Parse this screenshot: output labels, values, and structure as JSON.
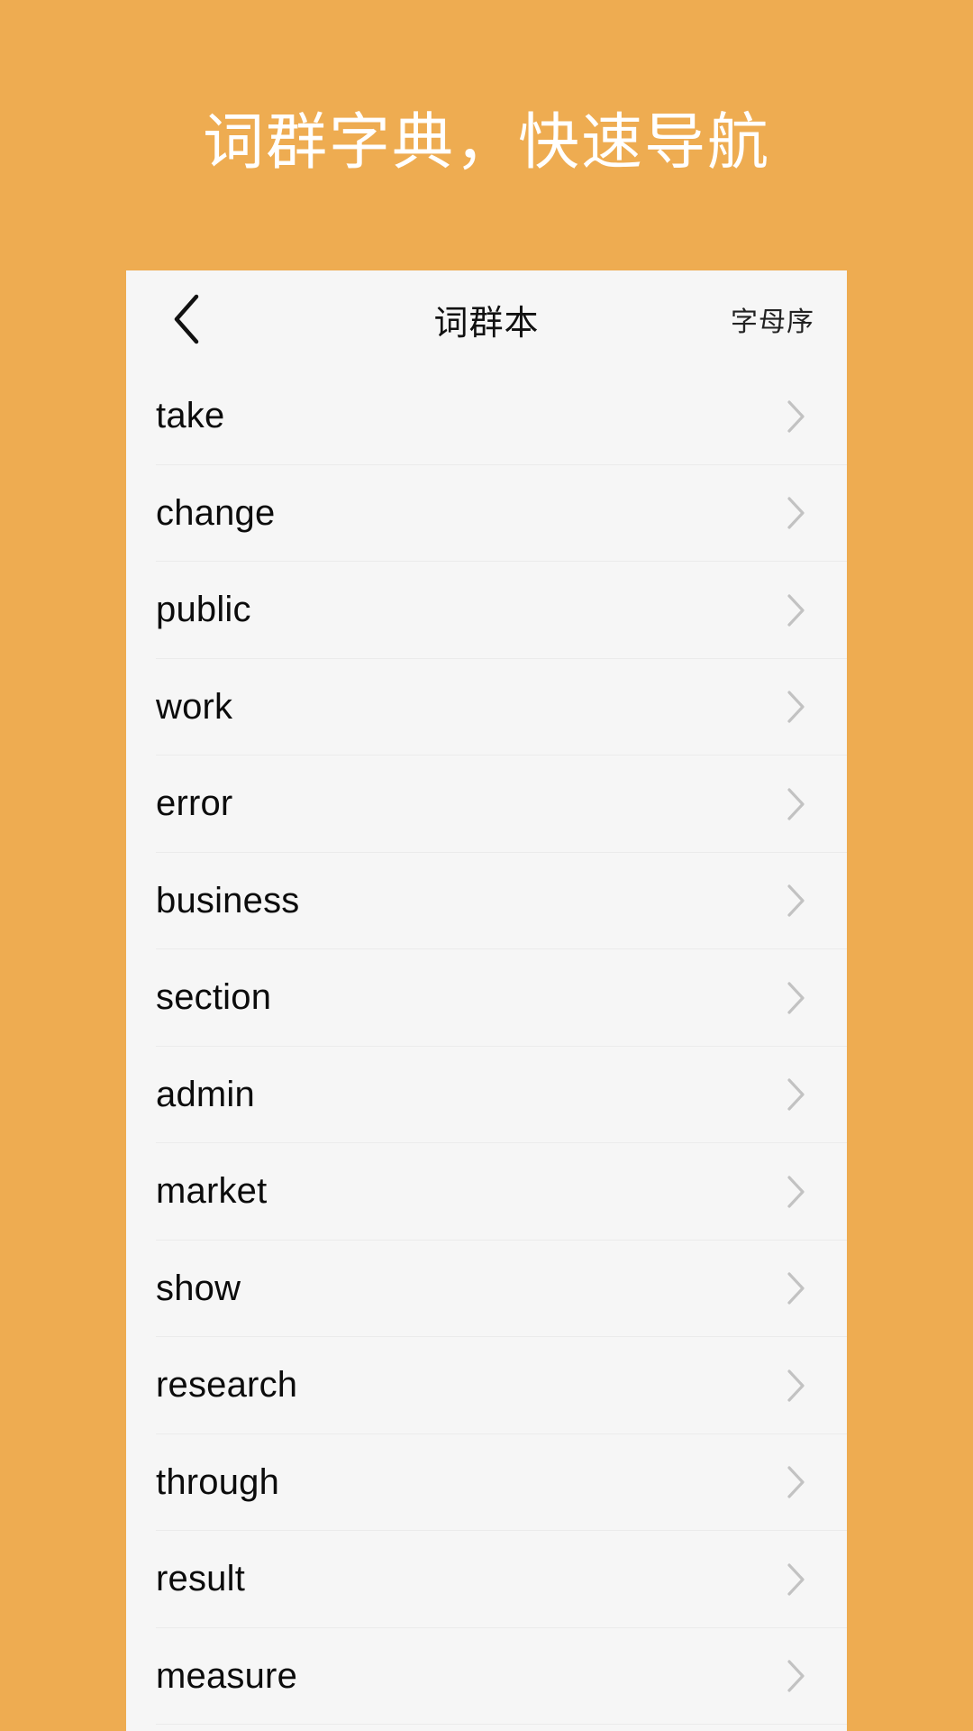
{
  "hero": {
    "title": "词群字典，快速导航",
    "background_color": "#eeac51",
    "text_color": "#ffffff"
  },
  "card": {
    "background_color": "#f6f6f6"
  },
  "navbar": {
    "back_icon": "chevron-left-icon",
    "title": "词群本",
    "action_label": "字母序"
  },
  "list": {
    "row_chevron_icon": "chevron-right-icon",
    "items": [
      {
        "label": "take"
      },
      {
        "label": "change"
      },
      {
        "label": "public"
      },
      {
        "label": "work"
      },
      {
        "label": "error"
      },
      {
        "label": "business"
      },
      {
        "label": "section"
      },
      {
        "label": "admin"
      },
      {
        "label": "market"
      },
      {
        "label": "show"
      },
      {
        "label": "research"
      },
      {
        "label": "through"
      },
      {
        "label": "result"
      },
      {
        "label": "measure"
      }
    ]
  }
}
